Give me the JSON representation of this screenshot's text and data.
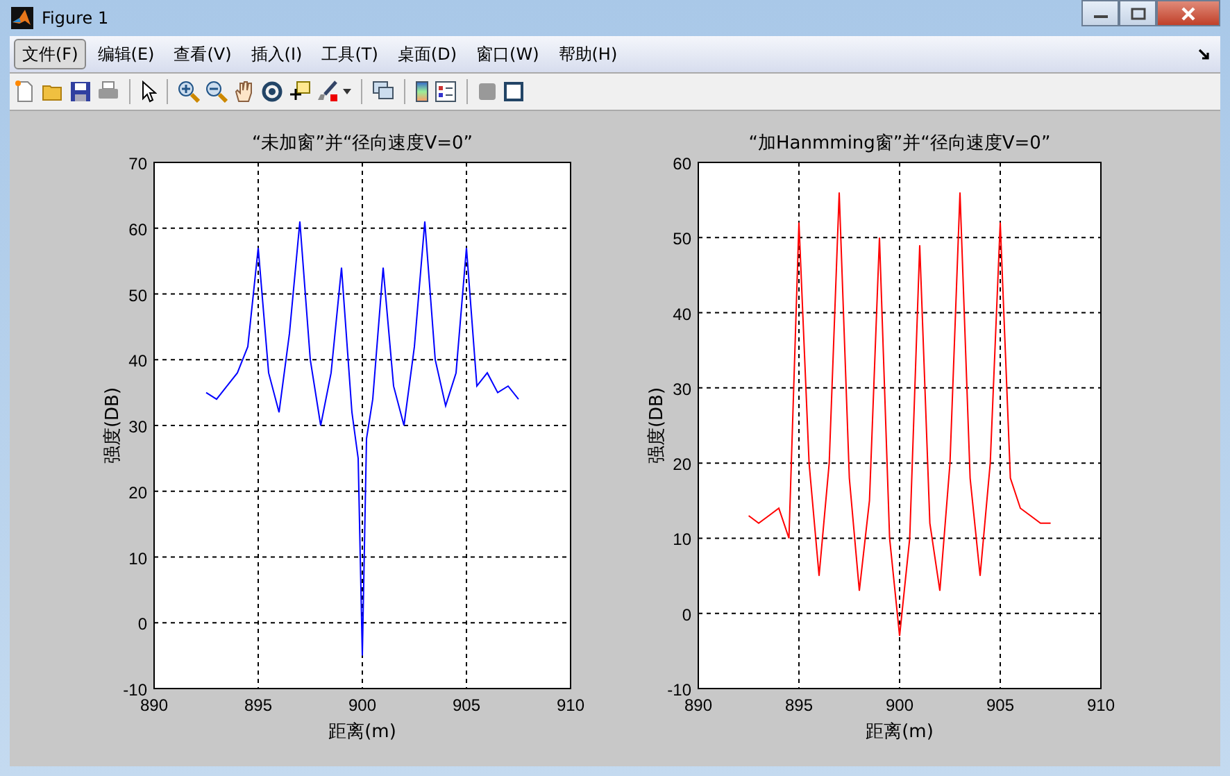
{
  "window": {
    "title": "Figure 1"
  },
  "menu": [
    {
      "label": "文件(F)",
      "selected": true
    },
    {
      "label": "编辑(E)",
      "selected": false
    },
    {
      "label": "查看(V)",
      "selected": false
    },
    {
      "label": "插入(I)",
      "selected": false
    },
    {
      "label": "工具(T)",
      "selected": false
    },
    {
      "label": "桌面(D)",
      "selected": false
    },
    {
      "label": "窗口(W)",
      "selected": false
    },
    {
      "label": "帮助(H)",
      "selected": false
    }
  ],
  "plots": [
    {
      "chart_data": {
        "type": "line",
        "title": "“未加窗”并“径向速度V=0”",
        "xlabel": "距离(m)",
        "ylabel": "强度(DB)",
        "xlim": [
          890,
          910
        ],
        "ylim": [
          -10,
          70
        ],
        "xticks": [
          890,
          895,
          900,
          905,
          910
        ],
        "yticks": [
          -10,
          0,
          10,
          20,
          30,
          40,
          50,
          60,
          70
        ],
        "x": [
          892.5,
          893,
          893.5,
          894,
          894.5,
          895,
          895.5,
          896,
          896.5,
          897,
          897.5,
          898,
          898.5,
          899,
          899.5,
          899.8,
          900,
          900.2,
          900.5,
          901,
          901.5,
          902,
          902.5,
          903,
          903.5,
          904,
          904.5,
          905,
          905.5,
          906,
          906.5,
          907,
          907.5
        ],
        "grid": true,
        "series": [
          {
            "color": "#0000ff",
            "values": [
              35,
              34,
              36,
              38,
              42,
              57,
              38,
              32,
              44,
              61,
              40,
              30,
              38,
              54,
              32,
              25,
              -5,
              28,
              34,
              54,
              36,
              30,
              42,
              61,
              40,
              33,
              38,
              57,
              36,
              38,
              35,
              36,
              34
            ]
          }
        ]
      }
    },
    {
      "chart_data": {
        "type": "line",
        "title": "“加Hanmming窗”并“径向速度V=0”",
        "xlabel": "距离(m)",
        "ylabel": "强度(DB)",
        "xlim": [
          890,
          910
        ],
        "ylim": [
          -10,
          60
        ],
        "xticks": [
          890,
          895,
          900,
          905,
          910
        ],
        "yticks": [
          -10,
          0,
          10,
          20,
          30,
          40,
          50,
          60
        ],
        "x": [
          892.5,
          893,
          893.5,
          894,
          894.5,
          895,
          895.5,
          896,
          896.5,
          897,
          897.5,
          898,
          898.5,
          899,
          899.5,
          900,
          900.5,
          901,
          901.5,
          902,
          902.5,
          903,
          903.5,
          904,
          904.5,
          905,
          905.5,
          906,
          906.5,
          907,
          907.5
        ],
        "grid": true,
        "series": [
          {
            "color": "#ff0000",
            "values": [
              13,
              12,
              13,
              14,
              10,
              52,
              20,
              5,
              20,
              56,
              18,
              3,
              15,
              50,
              10,
              -3,
              10,
              49,
              12,
              3,
              20,
              56,
              18,
              5,
              20,
              52,
              18,
              14,
              13,
              12,
              12
            ]
          }
        ]
      }
    }
  ]
}
